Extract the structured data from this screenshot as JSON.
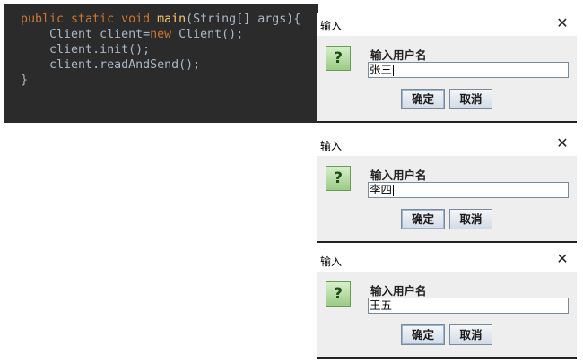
{
  "code": {
    "lines": [
      {
        "p1": "public static void ",
        "fn": "main",
        "p2": "(String[] args){"
      },
      {
        "indent": "    ",
        "t1": "Client client=",
        "kw": "new",
        "t2": " Client();"
      },
      {
        "indent": "    ",
        "t1": "client.init();"
      },
      {
        "indent": "    ",
        "t1": "client.readAndSend();"
      },
      {
        "t1": "}"
      }
    ]
  },
  "dialogs": [
    {
      "title": "输入",
      "close": "✕",
      "icon": "?",
      "prompt": "输入用户名",
      "value": "张三",
      "ok_label": "确定",
      "cancel_label": "取消"
    },
    {
      "title": "输入",
      "close": "✕",
      "icon": "?",
      "prompt": "输入用户名",
      "value": "李四",
      "ok_label": "确定",
      "cancel_label": "取消"
    },
    {
      "title": "输入",
      "close": "✕",
      "icon": "?",
      "prompt": "输入用户名",
      "value": "王五",
      "ok_label": "确定",
      "cancel_label": "取消"
    }
  ],
  "colors": {
    "code_bg": "#2b2b2b",
    "keyword": "#cc7832",
    "method": "#ffc66d",
    "text": "#a9b7c6",
    "dialog_bg": "#eeeeee"
  }
}
